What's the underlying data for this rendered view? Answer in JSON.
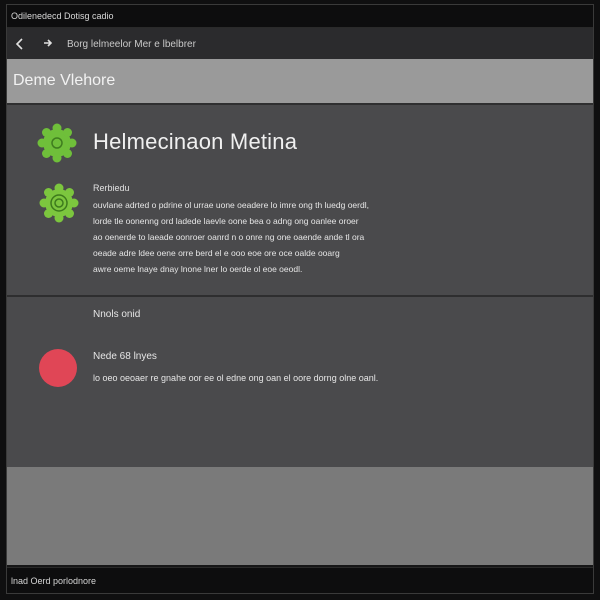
{
  "window": {
    "title": "Odilenedecd Dotisg cadio"
  },
  "nav": {
    "breadcrumb": "Borg lelmeelor Mer e lbelbrer"
  },
  "panel": {
    "header": "Deme Vlehore",
    "app_title": "Helmecinaon Metina",
    "description_title": "Rerbiedu",
    "description_lines": [
      "ouvlane adrted o pdrine ol urrae uone oeadere lo imre ong th luedg oerdl,",
      "lorde tle oonenng ord ladede laevle oone bea o adng ong oanlee oroer",
      "ao oenerde to laeade oonroer oanrd n o onre ng one oaende ande tl ora",
      "oeade adre ldee oene orre berd el e ooo eoe ore oce oalde ooarg",
      "awre oeme lnaye dnay lnone lner lo oerde ol eoe oeodl."
    ],
    "section_label": "Nnols onid",
    "item_title": "Nede 68 lnyes",
    "item_description": "lo oeo oeoaer re gnahe oor ee ol edne ong oan el oore dorng olne oanl."
  },
  "statusbar": {
    "text": "lnad Oerd porlodnore"
  },
  "colors": {
    "accent_green": "#6fbf3a",
    "alert_red": "#e04656"
  },
  "icons": {
    "app_badge_top": "gear-badge-icon",
    "app_badge_second": "swirl-badge-icon",
    "status_dot": "alert-dot-icon"
  }
}
